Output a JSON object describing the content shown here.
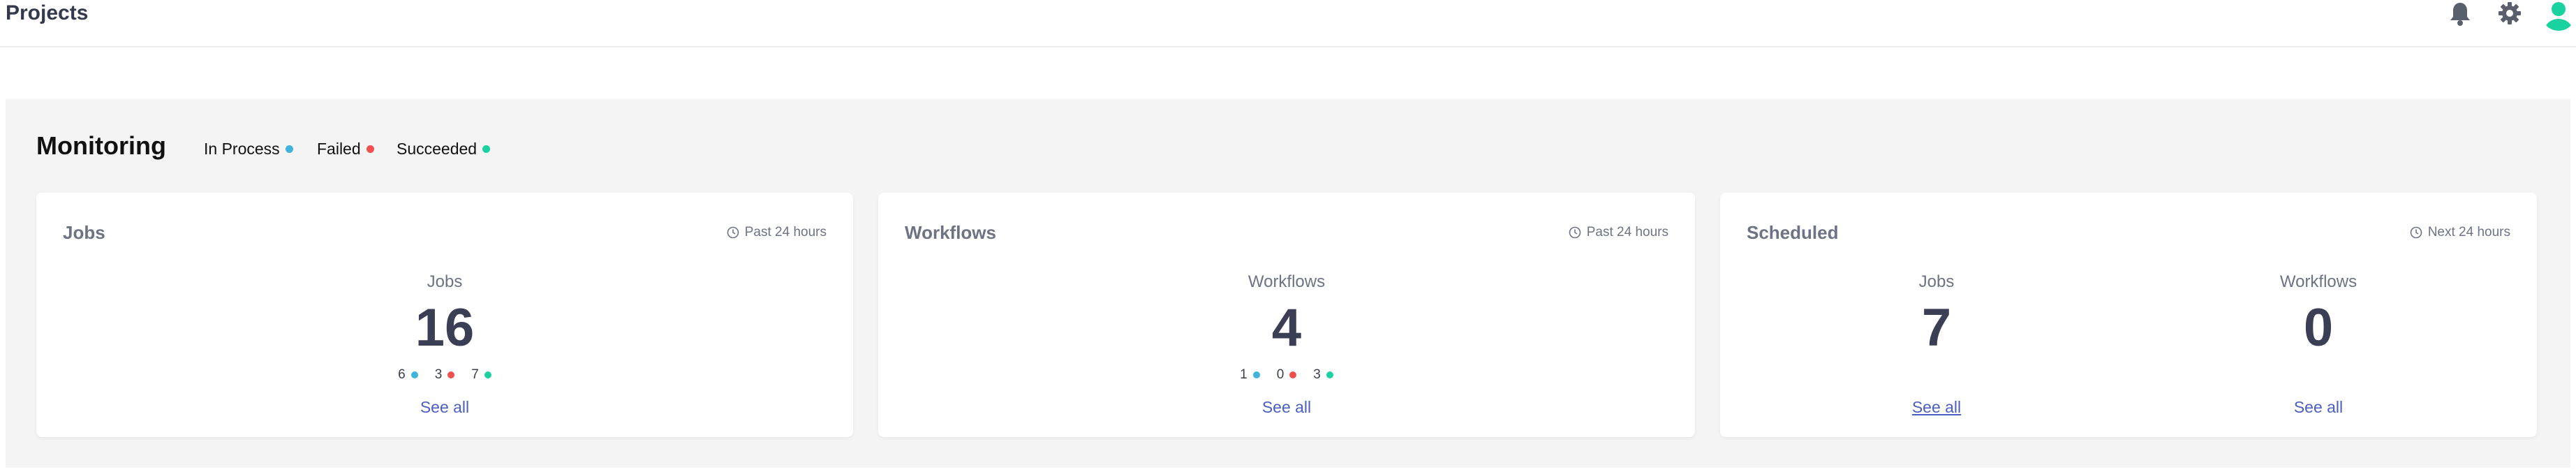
{
  "header": {
    "title": "Projects"
  },
  "monitoring": {
    "title": "Monitoring",
    "legend": [
      {
        "label": "In Process",
        "color": "#3fb3dc"
      },
      {
        "label": "Failed",
        "color": "#ef4f4f"
      },
      {
        "label": "Succeeded",
        "color": "#19d2a0"
      }
    ]
  },
  "cards": {
    "jobs": {
      "title": "Jobs",
      "period": "Past 24 hours",
      "label": "Jobs",
      "value": "16",
      "breakdown": [
        "6",
        "3",
        "7"
      ],
      "see_all": "See all"
    },
    "workflows": {
      "title": "Workflows",
      "period": "Past 24 hours",
      "label": "Workflows",
      "value": "4",
      "breakdown": [
        "1",
        "0",
        "3"
      ],
      "see_all": "See all"
    },
    "scheduled": {
      "title": "Scheduled",
      "period": "Next 24 hours",
      "jobs_label": "Jobs",
      "jobs_value": "7",
      "jobs_see_all": "See all",
      "workflows_label": "Workflows",
      "workflows_value": "0",
      "workflows_see_all": "See all"
    }
  },
  "icons": {
    "bell": "bell-icon",
    "settings": "gear-icon",
    "avatar": "user-avatar-icon",
    "clock": "clock-icon"
  },
  "colors": {
    "in_process": "#3fb3dc",
    "failed": "#ef4f4f",
    "succeeded": "#19d2a0",
    "link": "#4a5fc1",
    "avatar": "#19d2a0"
  }
}
